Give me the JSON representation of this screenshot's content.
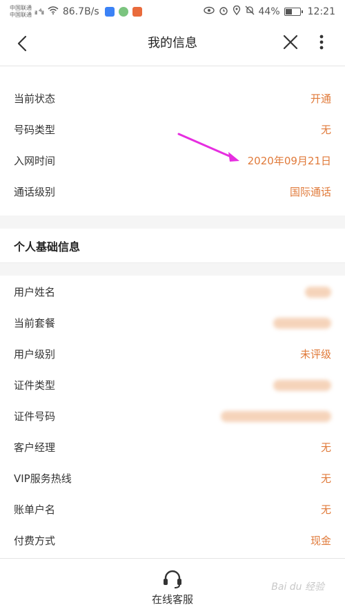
{
  "status_bar": {
    "carrier1": "中国联通",
    "carrier2": "中国联通",
    "signal": "ᵢₗₗ ⁴ᵢₗₗ",
    "speed": "86.7B/s",
    "battery": "44%",
    "time": "12:21",
    "battery_level": 0.44
  },
  "nav": {
    "title": "我的信息",
    "back_icon": "chevron-left-icon",
    "close_icon": "close-icon",
    "more_icon": "more-vertical-icon"
  },
  "basic": [
    {
      "label": "当前状态",
      "value": "开通"
    },
    {
      "label": "号码类型",
      "value": "无"
    },
    {
      "label": "入网时间",
      "value": "2020年09月21日"
    },
    {
      "label": "通话级别",
      "value": "国际通话"
    }
  ],
  "personal": {
    "header": "个人基础信息",
    "rows": [
      {
        "label": "用户姓名",
        "value": ""
      },
      {
        "label": "当前套餐",
        "value": ""
      },
      {
        "label": "用户级别",
        "value": "未评级"
      },
      {
        "label": "证件类型",
        "value": ""
      },
      {
        "label": "证件号码",
        "value": ""
      },
      {
        "label": "客户经理",
        "value": "无"
      },
      {
        "label": "VIP服务热线",
        "value": "无"
      },
      {
        "label": "账单户名",
        "value": "无"
      },
      {
        "label": "付费方式",
        "value": "现金"
      }
    ]
  },
  "bottom": {
    "label": "在线客服",
    "icon": "headset-icon",
    "watermark": "Bai du 经验"
  },
  "colors": {
    "accent": "#e07a3a",
    "arrow": "#e62ee0"
  }
}
